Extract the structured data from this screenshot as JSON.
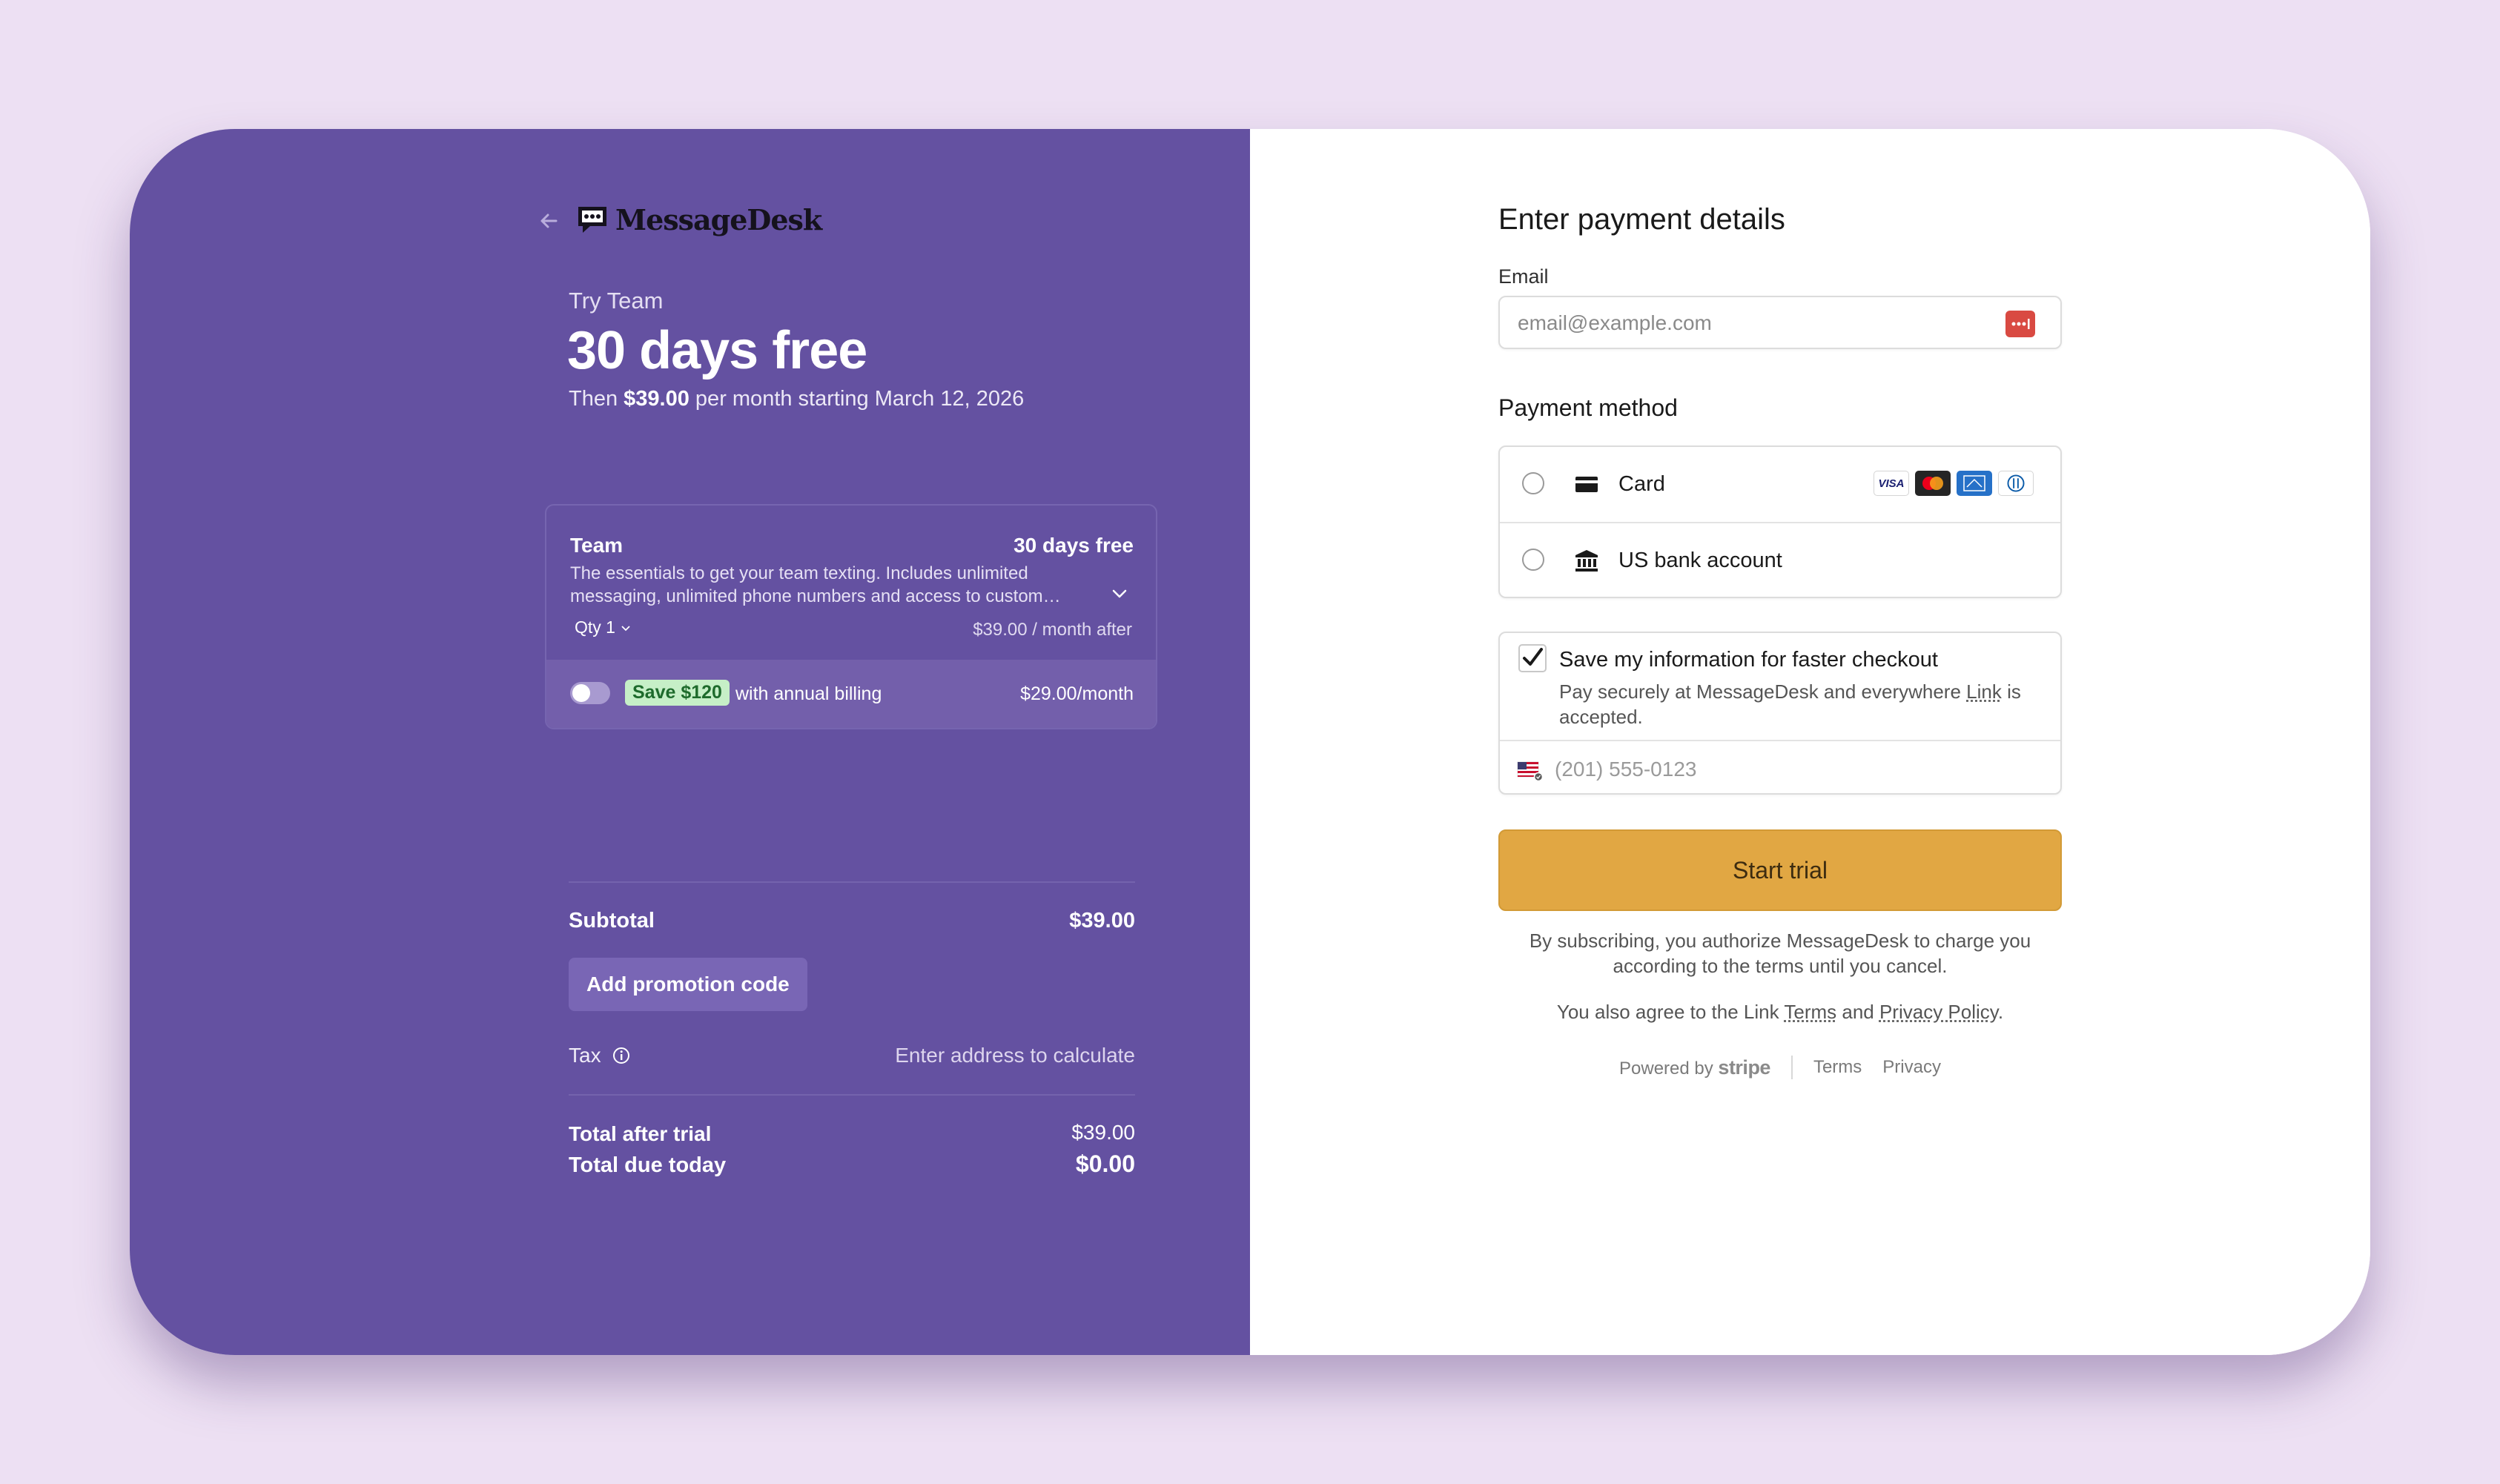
{
  "brand": {
    "name": "MessageDesk"
  },
  "summary": {
    "try_label": "Try Team",
    "headline": "30 days free",
    "then_prefix": "Then ",
    "then_price": "$39.00",
    "then_suffix": " per month starting March 12, 2026"
  },
  "plan": {
    "name": "Team",
    "trial": "30 days free",
    "description": "The essentials to get your team texting. Includes unlimited messaging, unlimited phone numbers and access to custom…",
    "qty_label": "Qty 1",
    "after_price": "$39.00 / month after",
    "annual": {
      "enabled": false,
      "badge": "Save $120",
      "label": "with annual billing",
      "price": "$29.00/month"
    }
  },
  "totals": {
    "subtotal_label": "Subtotal",
    "subtotal_value": "$39.00",
    "promo_button": "Add promotion code",
    "tax_label": "Tax",
    "tax_value": "Enter address to calculate",
    "after_trial_label": "Total after trial",
    "after_trial_value": "$39.00",
    "due_today_label": "Total due today",
    "due_today_value": "$0.00"
  },
  "payment": {
    "title": "Enter payment details",
    "email_label": "Email",
    "email_placeholder": "email@example.com",
    "method_label": "Payment method",
    "methods": [
      {
        "label": "Card",
        "icon": "credit-card-icon",
        "selected": false
      },
      {
        "label": "US bank account",
        "icon": "bank-icon",
        "selected": false
      }
    ],
    "card_brands": [
      "VISA",
      "Mastercard",
      "American Express",
      "Diners Club"
    ],
    "save_info": {
      "checked": true,
      "title": "Save my information for faster checkout",
      "desc_prefix": "Pay securely at MessageDesk and everywhere ",
      "desc_link": "Link",
      "desc_suffix": " is accepted.",
      "phone_placeholder": "(201) 555-0123"
    },
    "submit_label": "Start trial",
    "legal_text": "By subscribing, you authorize MessageDesk to charge you according to the terms until you cancel.",
    "agree_prefix": "You also agree to the Link ",
    "agree_terms": "Terms",
    "agree_mid": " and ",
    "agree_privacy": "Privacy Policy",
    "agree_end": ".",
    "footer": {
      "powered_by": "Powered by",
      "stripe": "stripe",
      "terms": "Terms",
      "privacy": "Privacy"
    }
  },
  "colors": {
    "left_bg": "#6451a1",
    "page_bg": "#ede0f3",
    "submit_bg": "#e1a743",
    "badge_bg": "#c6efc7"
  }
}
